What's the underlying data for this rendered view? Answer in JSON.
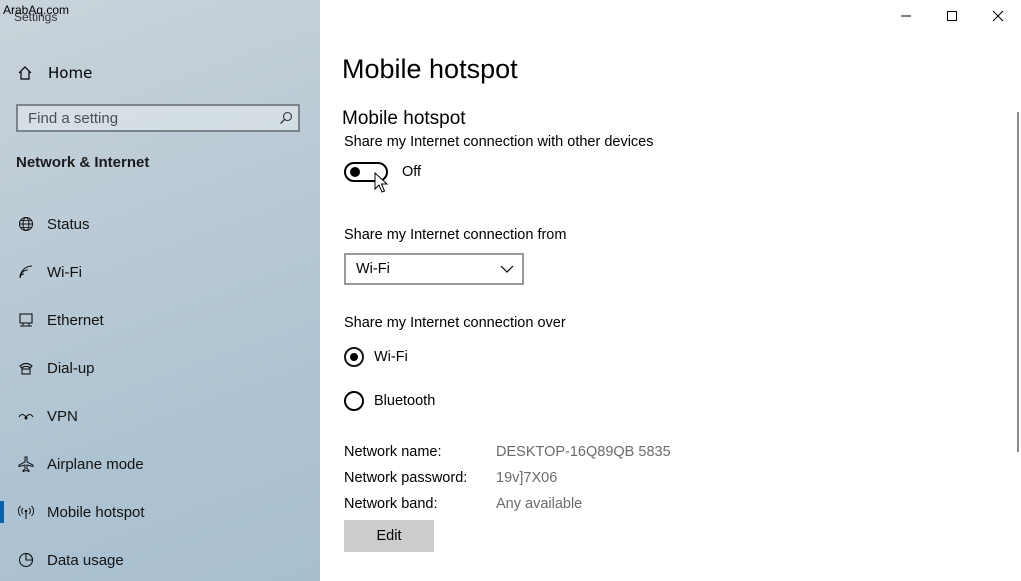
{
  "watermark": "ArabAq.com",
  "app": {
    "title": "Settings"
  },
  "sidebar": {
    "home_label": "Home",
    "search_placeholder": "Find a setting",
    "section_title": "Network & Internet",
    "items": [
      {
        "label": "Status",
        "icon": "globe-icon"
      },
      {
        "label": "Wi-Fi",
        "icon": "wifi-icon"
      },
      {
        "label": "Ethernet",
        "icon": "ethernet-icon"
      },
      {
        "label": "Dial-up",
        "icon": "dialup-icon"
      },
      {
        "label": "VPN",
        "icon": "vpn-icon"
      },
      {
        "label": "Airplane mode",
        "icon": "airplane-icon"
      },
      {
        "label": "Mobile hotspot",
        "icon": "hotspot-icon",
        "selected": true
      },
      {
        "label": "Data usage",
        "icon": "data-usage-icon"
      }
    ]
  },
  "main": {
    "page_title": "Mobile hotspot",
    "section_title": "Mobile hotspot",
    "share_label": "Share my Internet connection with other devices",
    "toggle_state": "Off",
    "share_from_label": "Share my Internet connection from",
    "share_from_value": "Wi-Fi",
    "share_over_label": "Share my Internet connection over",
    "share_over_options": [
      {
        "label": "Wi-Fi",
        "checked": true
      },
      {
        "label": "Bluetooth",
        "checked": false
      }
    ],
    "network_info": [
      {
        "key": "Network name:",
        "value": "DESKTOP-16Q89QB 5835"
      },
      {
        "key": "Network password:",
        "value": "19v]7X06"
      },
      {
        "key": "Network band:",
        "value": "Any available"
      }
    ],
    "edit_label": "Edit"
  },
  "colors": {
    "accent": "#0063b1",
    "sidebar_bg": "#b8c9d6"
  }
}
